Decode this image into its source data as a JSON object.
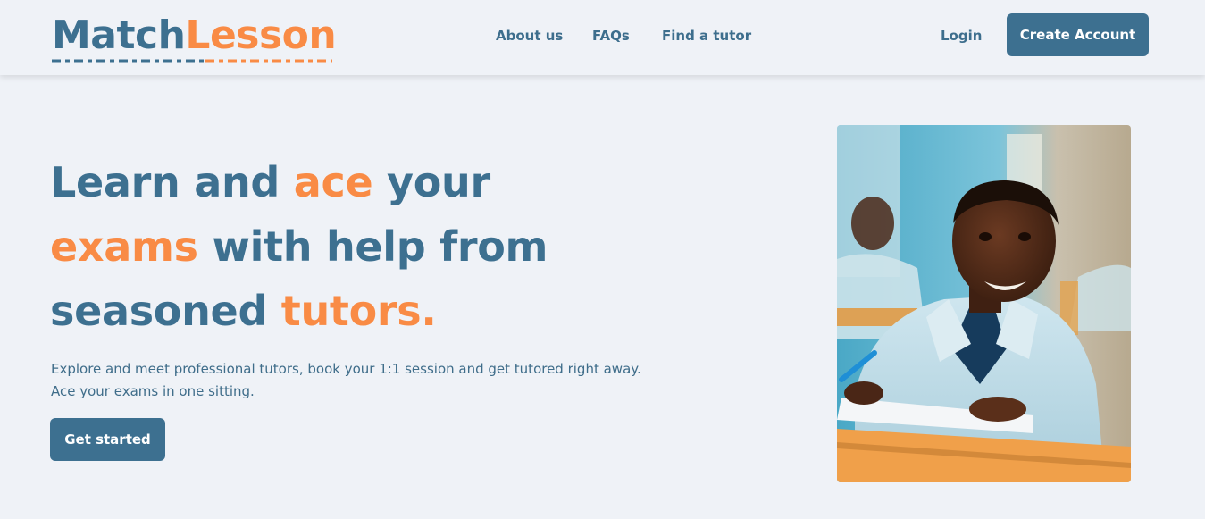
{
  "brand": {
    "part1": "Match",
    "part2": "Lesson"
  },
  "nav": {
    "about": "About us",
    "faqs": "FAQs",
    "find_tutor": "Find a tutor"
  },
  "auth": {
    "login": "Login",
    "create_account": "Create Account"
  },
  "hero": {
    "title": {
      "w1": "Learn and ",
      "w2": "ace",
      "w3": " your ",
      "w4": "exams",
      "w5": " with help from seasoned ",
      "w6": "tutors."
    },
    "subtitle": "Explore and meet professional tutors, book your 1:1 session and get tutored right away. Ace your exams in one sitting.",
    "cta": "Get started"
  },
  "colors": {
    "primary": "#3d7090",
    "accent": "#f98b45",
    "background": "#eff2f7"
  },
  "image": {
    "subject": "smiling student writing at a desk in a classroom"
  }
}
